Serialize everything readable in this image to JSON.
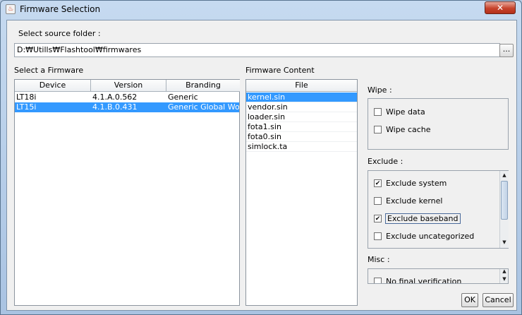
{
  "window": {
    "title": "Firmware Selection",
    "close_label": "✕",
    "app_icon": "java-icon"
  },
  "source": {
    "label": "Select source folder :",
    "path": "D:₩Utills₩Flashtool₩firmwares",
    "browse_label": "..."
  },
  "firmware": {
    "label": "Select a Firmware",
    "columns": [
      "Device",
      "Version",
      "Branding"
    ],
    "rows": [
      {
        "device": "LT18i",
        "version": "4.1.A.0.562",
        "branding": "Generic"
      },
      {
        "device": "LT15i",
        "version": "4.1.B.0.431",
        "branding": "Generic Global World"
      }
    ],
    "selected_index": 1
  },
  "content": {
    "label": "Firmware Content",
    "column": "File",
    "files": [
      "kernel.sin",
      "vendor.sin",
      "loader.sin",
      "fota1.sin",
      "fota0.sin",
      "simlock.ta"
    ],
    "selected_index": 0
  },
  "wipe": {
    "label": "Wipe :",
    "options": [
      {
        "label": "Wipe data",
        "checked": false
      },
      {
        "label": "Wipe cache",
        "checked": false
      }
    ]
  },
  "exclude": {
    "label": "Exclude :",
    "options": [
      {
        "label": "Exclude system",
        "checked": true
      },
      {
        "label": "Exclude kernel",
        "checked": false
      },
      {
        "label": "Exclude baseband",
        "checked": true
      },
      {
        "label": "Exclude uncategorized",
        "checked": false
      }
    ]
  },
  "misc": {
    "label": "Misc :",
    "options": [
      {
        "label": "No final verification",
        "checked": false
      }
    ]
  },
  "buttons": {
    "ok": "OK",
    "cancel": "Cancel"
  }
}
